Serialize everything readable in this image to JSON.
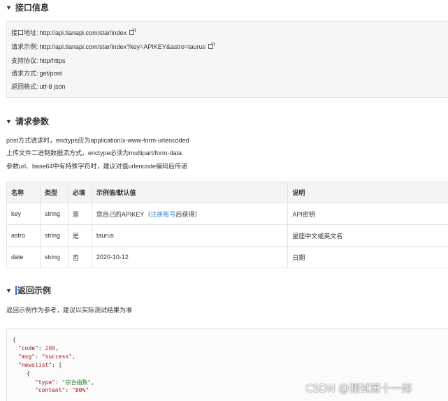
{
  "sections": {
    "api_info": "接口信息",
    "request_params": "请求参数",
    "response_example": "返回示例"
  },
  "api_info": {
    "rows": [
      {
        "label": "接口地址:",
        "value": "http://api.tianapi.com/star/index",
        "icon": "external-link-icon"
      },
      {
        "label": "请求示例:",
        "value": "http://api.tianapi.com/star/index?key=APIKEY&astro=taurus",
        "icon": "external-link-icon"
      },
      {
        "label": "支持协议:",
        "value": "http/https"
      },
      {
        "label": "请求方式:",
        "value": "get/post"
      },
      {
        "label": "返回格式:",
        "value": "utf-8 json"
      }
    ]
  },
  "request_notes": [
    "post方式请求时，enctype应为application/x-www-form-urlencoded",
    "上传文件二进制数据流方式，enctype必须为multipart/form-data",
    "参数url、base64中有特殊字符时，建议对值urlencode编码后传递"
  ],
  "params_table": {
    "headers": [
      "名称",
      "类型",
      "必填",
      "示例值/默认值",
      "说明"
    ],
    "rows": [
      {
        "name": "key",
        "type": "string",
        "required": "是",
        "example_pre": "您自己的APIKEY（",
        "example_link": "注册账号",
        "example_post": "后获得）",
        "desc": "API密钥"
      },
      {
        "name": "astro",
        "type": "string",
        "required": "是",
        "example": "taurus",
        "desc": "星座中文或英文名"
      },
      {
        "name": "date",
        "type": "string",
        "required": "否",
        "example": "2020-10-12",
        "desc": "日期"
      }
    ]
  },
  "response_note": "返回示例作为参考，建议以实际测试结果为准",
  "code": {
    "open_brace": "{",
    "code_key": "\"code\"",
    "code_val": "200",
    "msg_key": "\"msg\"",
    "msg_val": "\"success\"",
    "newslist_key": "\"newslist\"",
    "open_bracket": "[",
    "inner_brace": "{",
    "type_key": "\"type\"",
    "type_val": "\"综合指数\"",
    "content_key": "\"content\"",
    "content_val": "\"80%\""
  },
  "watermark": "CSDN @测试萧十一郎"
}
